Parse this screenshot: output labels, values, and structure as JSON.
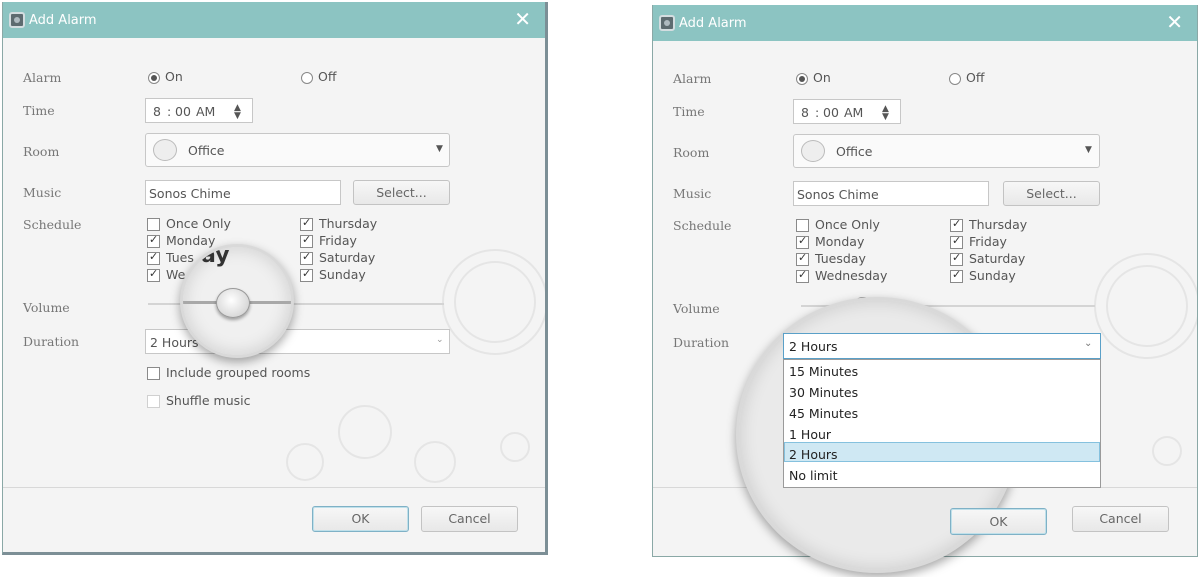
{
  "dialog": {
    "title": "Add Alarm",
    "close_glyph": "✕",
    "icon": "sonos-app-icon"
  },
  "labels": {
    "alarm": "Alarm",
    "time": "Time",
    "room": "Room",
    "music": "Music",
    "schedule": "Schedule",
    "volume": "Volume",
    "duration": "Duration"
  },
  "alarm": {
    "on_label": "On",
    "off_label": "Off",
    "selected": "On"
  },
  "time": {
    "hour": "8",
    "sep": ":",
    "minute": "00",
    "ampm": "AM"
  },
  "room": {
    "value": "Office",
    "icon": "speaker-icon"
  },
  "music": {
    "value": "Sonos Chime",
    "select_button": "Select..."
  },
  "schedule": {
    "days": [
      {
        "label": "Once Only",
        "checked": false
      },
      {
        "label": "Monday",
        "checked": true
      },
      {
        "label": "Tuesday",
        "checked": true
      },
      {
        "label": "Wednesday",
        "checked": true
      },
      {
        "label": "Thursday",
        "checked": true
      },
      {
        "label": "Friday",
        "checked": true
      },
      {
        "label": "Saturday",
        "checked": true
      },
      {
        "label": "Sunday",
        "checked": true
      }
    ],
    "left_partial": [
      "Once Only",
      "Monday",
      "Tues",
      "We"
    ]
  },
  "volume": {
    "level": 0.4
  },
  "duration": {
    "value": "2 Hours",
    "options": [
      "15 Minutes",
      "30 Minutes",
      "45 Minutes",
      "1 Hour",
      "2 Hours",
      "No limit"
    ],
    "selected": "2 Hours"
  },
  "options": {
    "include_grouped": "Include grouped rooms",
    "shuffle": "Shuffle music"
  },
  "buttons": {
    "ok": "OK",
    "cancel": "Cancel"
  },
  "magnifier_text": "ay"
}
